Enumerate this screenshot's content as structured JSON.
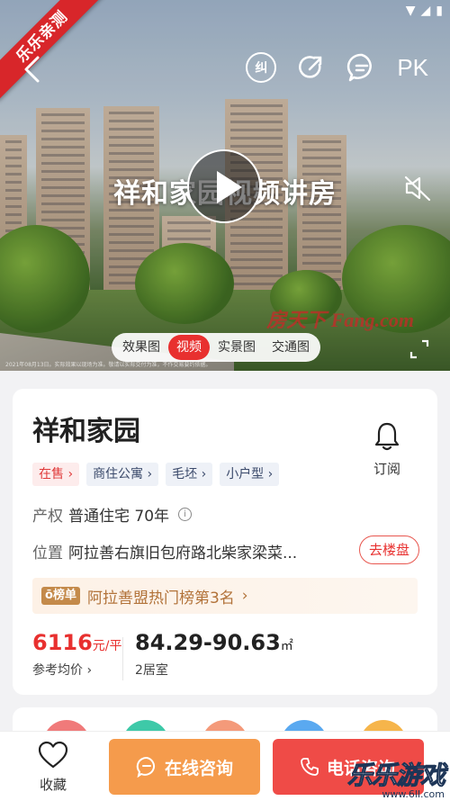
{
  "ribbon": {
    "text": "乐乐亲测"
  },
  "header": {
    "correct_icon_text": "纠",
    "pk_label": "PK"
  },
  "hero": {
    "video_title": "祥和家园视频讲房",
    "watermark": "房天下 Fang.com",
    "disclaimer": "2021年08月13日。实际效果以现场为准。敬请以实际交付为准，不作交易要约依据。"
  },
  "media_tabs": [
    {
      "label": "效果图",
      "active": false
    },
    {
      "label": "视频",
      "active": true
    },
    {
      "label": "实景图",
      "active": false
    },
    {
      "label": "交通图",
      "active": false
    }
  ],
  "project": {
    "name": "祥和家园",
    "subscribe_label": "订阅",
    "tags": [
      {
        "label": "在售",
        "style": "red"
      },
      {
        "label": "商住公寓",
        "style": "blue"
      },
      {
        "label": "毛坯",
        "style": "blue"
      },
      {
        "label": "小户型",
        "style": "blue"
      }
    ],
    "property_right_key": "产权",
    "property_right_value": "普通住宅 70年",
    "location_key": "位置",
    "location_value": "阿拉善右旗旧包府路北柴家梁菜...",
    "go_button": "去楼盘",
    "rank_badge": "榜单",
    "rank_text": "阿拉善盟热门榜第3名",
    "price_value": "6116",
    "price_unit": "元/平",
    "price_label": "参考均价",
    "area_value": "84.29-90.63",
    "area_unit": "㎡",
    "area_label": "2居室"
  },
  "bottom_bar": {
    "favorite_label": "收藏",
    "consult_label": "在线咨询",
    "call_label": "电话咨询"
  },
  "site_watermark": {
    "text": "乐乐游戏",
    "url": "www.6ll.com"
  },
  "colors": {
    "accent_red": "#e8302f",
    "consult_orange": "#f59b4c",
    "call_red": "#ef4b47",
    "rank_gold": "#b2733a"
  }
}
